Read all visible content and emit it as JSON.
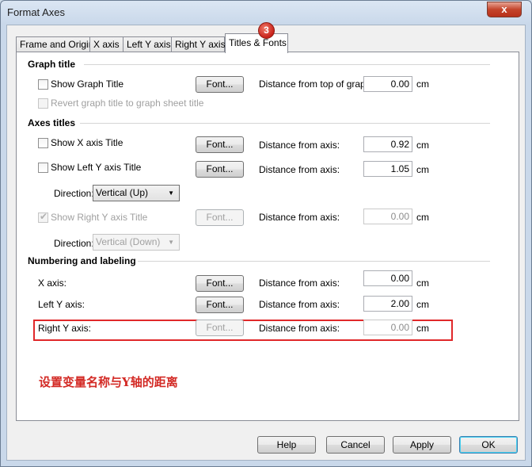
{
  "window": {
    "title": "Format Axes",
    "close_label": "x"
  },
  "tabs": [
    {
      "label": "Frame and Origin"
    },
    {
      "label": "X axis"
    },
    {
      "label": "Left Y axis"
    },
    {
      "label": "Right Y axis"
    },
    {
      "label": "Titles & Fonts",
      "active": true
    }
  ],
  "step_badge": "3",
  "unit": "cm",
  "graph_title": {
    "heading": "Graph title",
    "show_label": "Show Graph Title",
    "show_checked": false,
    "font_button": "Font...",
    "distance_label": "Distance from top of graph:",
    "distance_value": "0.00",
    "revert_label": "Revert graph title to graph sheet title",
    "revert_checked": false
  },
  "axes_titles": {
    "heading": "Axes titles",
    "x_label": "Show X axis Title",
    "x_checked": false,
    "x_font": "Font...",
    "x_distance_label": "Distance from axis:",
    "x_distance_value": "0.92",
    "left_label": "Show Left Y axis Title",
    "left_checked": false,
    "left_font": "Font...",
    "left_distance_label": "Distance from axis:",
    "left_distance_value": "1.05",
    "left_direction_label": "Direction:",
    "left_direction_value": "Vertical (Up)",
    "right_label": "Show Right Y axis Title",
    "right_checked": true,
    "right_font": "Font...",
    "right_distance_label": "Distance from axis:",
    "right_distance_value": "0.00",
    "right_direction_label": "Direction:",
    "right_direction_value": "Vertical (Down)"
  },
  "numbering": {
    "heading": "Numbering and labeling",
    "x_label": "X axis:",
    "x_font": "Font...",
    "x_distance_label": "Distance from axis:",
    "x_distance_value": "0.00",
    "left_label": "Left Y axis:",
    "left_font": "Font...",
    "left_distance_label": "Distance from axis:",
    "left_distance_value": "2.00",
    "right_label": "Right Y axis:",
    "right_font": "Font...",
    "right_distance_label": "Distance from axis:",
    "right_distance_value": "0.00"
  },
  "annotation": "设置变量名称与Y轴的距离",
  "footer": {
    "help": "Help",
    "cancel": "Cancel",
    "apply": "Apply",
    "ok": "OK"
  },
  "colors": {
    "annotation": "#d32a25",
    "highlight_border": "#e0282a",
    "badge": "#c8221a"
  }
}
